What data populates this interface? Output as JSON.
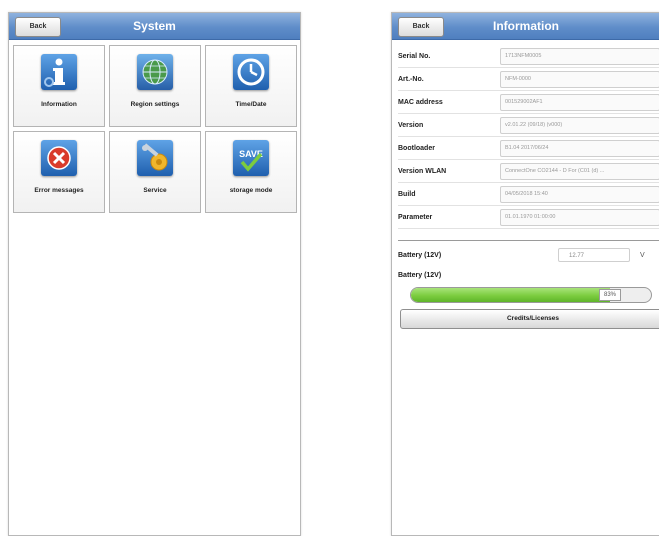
{
  "left_screen": {
    "back_label": "Back",
    "title": "System",
    "tiles": [
      {
        "label": "Information",
        "icon": "information-icon"
      },
      {
        "label": "Region settings",
        "icon": "globe-icon"
      },
      {
        "label": "Time/Date",
        "icon": "clock-icon"
      },
      {
        "label": "Error messages",
        "icon": "error-icon"
      },
      {
        "label": "Service",
        "icon": "tools-icon"
      },
      {
        "label": "storage mode",
        "icon": "save-icon",
        "icon_text": "SAVE"
      }
    ]
  },
  "right_screen": {
    "back_label": "Back",
    "title": "Information",
    "rows": [
      {
        "label": "Serial No.",
        "value": "1713NFM0005"
      },
      {
        "label": "Art.-No.",
        "value": "NFM-0000"
      },
      {
        "label": "MAC address",
        "value": "001529002AF1"
      },
      {
        "label": "Version",
        "value": "v2.01.22 (09/18) (v000)"
      },
      {
        "label": "Bootloader",
        "value": "B1.04 2017/06/24"
      },
      {
        "label": "Version WLAN",
        "value": "ConnectOne CO2144 - D For (C01 (d) ..."
      },
      {
        "label": "Build",
        "value": "04/05/2018 15:40"
      },
      {
        "label": "Parameter",
        "value": "01.01.1970 01:00:00"
      }
    ],
    "battery": {
      "label": "Battery (12V)",
      "value": "12.77",
      "unit": "V"
    },
    "battery_level": {
      "label": "Battery (12V)",
      "percent": 83,
      "percent_text": "83%"
    },
    "credits_label": "Credits/Licenses"
  },
  "colors": {
    "titlebar": "#5f8dc9",
    "progress_green": "#7ccc3f",
    "error_red": "#d93b2b"
  }
}
